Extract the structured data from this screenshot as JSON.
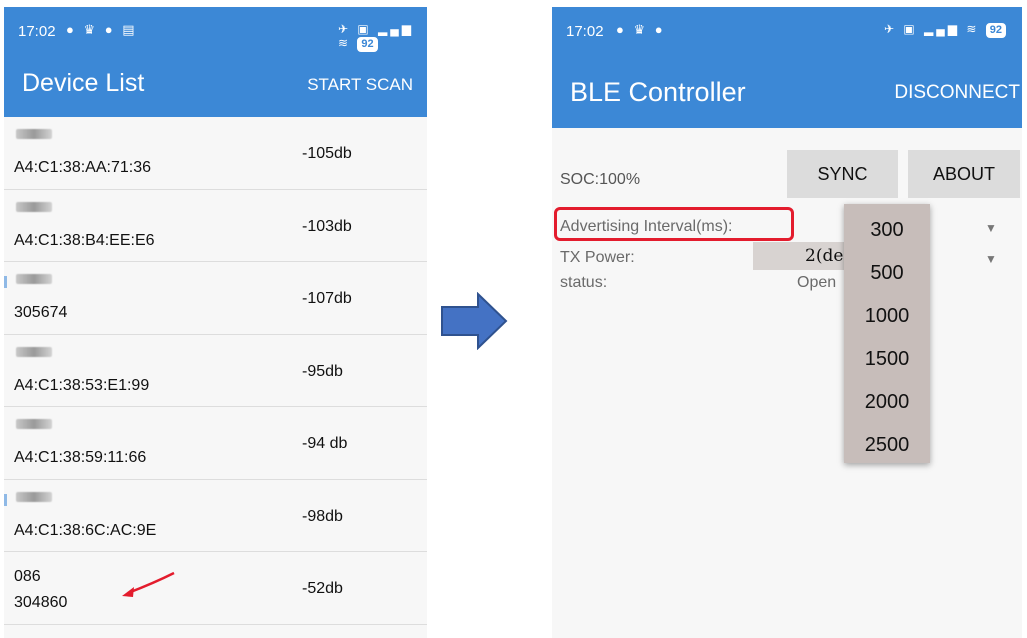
{
  "left": {
    "statusbar": {
      "time": "17:02",
      "battery": "92"
    },
    "appbar": {
      "title": "Device List",
      "action": "START SCAN"
    },
    "devices": [
      {
        "name1": "",
        "name2": "A4:C1:38:AA:71:36",
        "rssi": "-105db"
      },
      {
        "name1": "",
        "name2": "A4:C1:38:B4:EE:E6",
        "rssi": "-103db"
      },
      {
        "name1": "",
        "name2": "305674",
        "rssi": "-107db"
      },
      {
        "name1": "",
        "name2": "A4:C1:38:53:E1:99",
        "rssi": "-95db"
      },
      {
        "name1": "",
        "name2": "A4:C1:38:59:11:66",
        "rssi": "-94 db"
      },
      {
        "name1": "",
        "name2": "A4:C1:38:6C:AC:9E",
        "rssi": "-98db"
      },
      {
        "name1": "086",
        "name2": "304860",
        "rssi": "-52db"
      }
    ]
  },
  "right": {
    "statusbar": {
      "time": "17:02",
      "battery": "92"
    },
    "appbar": {
      "title": "BLE Controller",
      "action": "DISCONNECT"
    },
    "soc": "SOC:100%",
    "sync_label": "SYNC",
    "about_label": "ABOUT",
    "adv_label": "Advertising Interval(ms):",
    "tx_label": "TX Power:",
    "tx_value": "2(de",
    "status_label": "status:",
    "status_value": "Open",
    "dropdown_options": [
      "300",
      "500",
      "1000",
      "1500",
      "2000",
      "2500"
    ]
  },
  "colors": {
    "appbar": "#3c88d6",
    "highlight": "#e31c2d",
    "dropdown_bg": "#c7bdba",
    "arrow": "#4472c4"
  }
}
